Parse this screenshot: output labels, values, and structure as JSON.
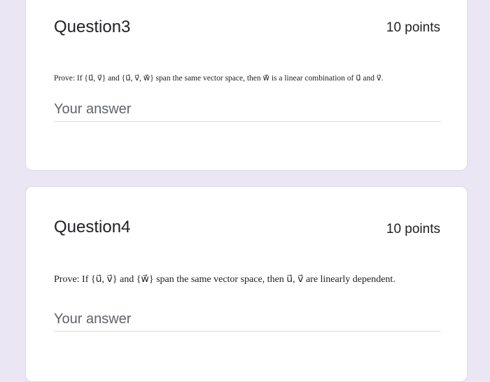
{
  "questions": [
    {
      "title": "Question3",
      "points": "10 points",
      "prompt": "Prove: If {u⃗, v⃗} and {u⃗, v⃗, w⃗} span the same vector space, then w⃗ is a linear combination of u⃗ and v⃗.",
      "answer_placeholder": "Your answer"
    },
    {
      "title": "Question4",
      "points": "10 points",
      "prompt": "Prove: If {u⃗, v⃗} and {w⃗} span the same vector space, then u⃗, v⃗ are linearly dependent.",
      "answer_placeholder": "Your answer"
    }
  ],
  "colors": {
    "page_background": "#ebe6f3",
    "card_background": "#ffffff",
    "text": "#202124",
    "placeholder_text": "#5f6368",
    "divider": "#dadce0"
  }
}
